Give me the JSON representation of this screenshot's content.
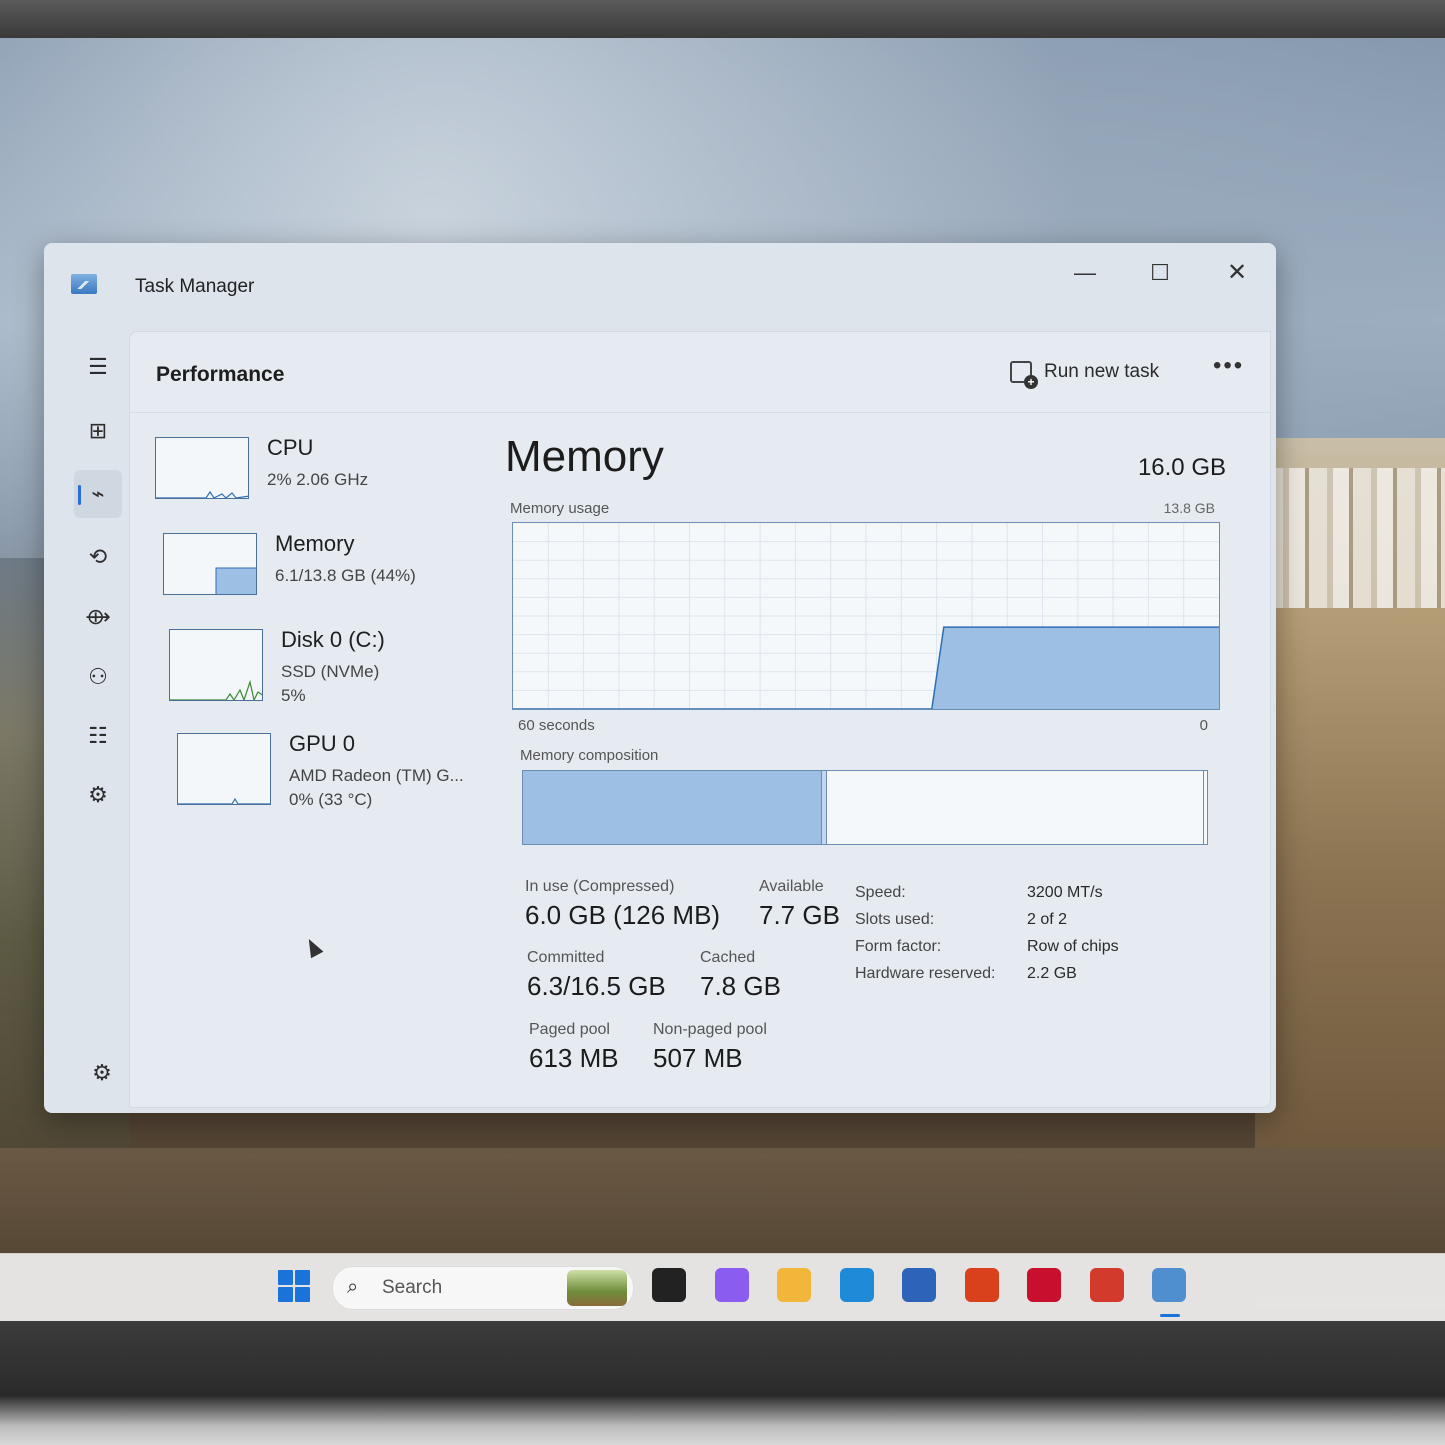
{
  "window": {
    "title": "Task Manager",
    "controls": {
      "minimize": "—",
      "maximize": "☐",
      "close": "✕"
    }
  },
  "nav": {
    "items": [
      {
        "name": "menu",
        "glyph": "☰"
      },
      {
        "name": "processes",
        "glyph": "⊞"
      },
      {
        "name": "performance",
        "glyph": "⌁",
        "active": true
      },
      {
        "name": "app-history",
        "glyph": "⟲"
      },
      {
        "name": "startup-apps",
        "glyph": "⟴"
      },
      {
        "name": "users",
        "glyph": "⚇"
      },
      {
        "name": "details",
        "glyph": "☷"
      },
      {
        "name": "services",
        "glyph": "⚙"
      }
    ],
    "settings_glyph": "⚙"
  },
  "header": {
    "page_title": "Performance",
    "run_new_task": "Run new task",
    "more": "•••"
  },
  "perf_list": [
    {
      "name": "CPU",
      "sub1": "2% 2.06 GHz",
      "sub2": "",
      "sub3": ""
    },
    {
      "name": "Memory",
      "sub1": "6.1/13.8 GB (44%)",
      "sub2": "",
      "sub3": ""
    },
    {
      "name": "Disk 0 (C:)",
      "sub1": "SSD (NVMe)",
      "sub2": "5%",
      "sub3": ""
    },
    {
      "name": "GPU 0",
      "sub1": "AMD Radeon (TM) G...",
      "sub2": "0% (33 °C)",
      "sub3": ""
    }
  ],
  "memory": {
    "title": "Memory",
    "total": "16.0 GB",
    "usage_label": "Memory usage",
    "usage_max": "13.8 GB",
    "time_left": "60 seconds",
    "time_right": "0",
    "usage_history_fraction": [
      0,
      0,
      0,
      0,
      0,
      0,
      0,
      0,
      0,
      0,
      0,
      0,
      0,
      0,
      0,
      0,
      0,
      0,
      0,
      0,
      0,
      0,
      0,
      0,
      0,
      0,
      0,
      0,
      0,
      0,
      0,
      0,
      0,
      0,
      0,
      0,
      0.44,
      0.44,
      0.44,
      0.44,
      0.44,
      0.44,
      0.44,
      0.44,
      0.44,
      0.44,
      0.44,
      0.44,
      0.44,
      0.44,
      0.44,
      0.44,
      0.44,
      0.44,
      0.44,
      0.44,
      0.44,
      0.44,
      0.44,
      0.44
    ],
    "composition_label": "Memory composition",
    "composition": {
      "in_use_fraction": 0.435,
      "modified_fraction": 0.01,
      "standby_fraction": 0.555
    },
    "stats": {
      "in_use_label": "In use (Compressed)",
      "in_use_value": "6.0 GB (126 MB)",
      "available_label": "Available",
      "available_value": "7.7 GB",
      "committed_label": "Committed",
      "committed_value": "6.3/16.5 GB",
      "cached_label": "Cached",
      "cached_value": "7.8 GB",
      "paged_label": "Paged pool",
      "paged_value": "613 MB",
      "nonpaged_label": "Non-paged pool",
      "nonpaged_value": "507 MB"
    },
    "specs": [
      {
        "key": "Speed:",
        "value": "3200 MT/s"
      },
      {
        "key": "Slots used:",
        "value": "2 of 2"
      },
      {
        "key": "Form factor:",
        "value": "Row of chips"
      },
      {
        "key": "Hardware reserved:",
        "value": "2.2 GB"
      }
    ]
  },
  "taskbar": {
    "search_placeholder": "Search",
    "apps": [
      {
        "name": "terminal",
        "color": "#222222"
      },
      {
        "name": "copilot",
        "color": "#8a5cf0"
      },
      {
        "name": "file-explorer",
        "color": "#f2b63a"
      },
      {
        "name": "edge",
        "color": "#1f8ad8"
      },
      {
        "name": "store",
        "color": "#2d63b8"
      },
      {
        "name": "l-app",
        "color": "#d9401c"
      },
      {
        "name": "mcafee",
        "color": "#c8102e"
      },
      {
        "name": "red-app",
        "color": "#d23a2c"
      },
      {
        "name": "task-manager",
        "color": "#4f8fd0"
      }
    ]
  },
  "colors": {
    "accent": "#2a6bd6",
    "graph_fill": "#9cbfe3",
    "graph_border": "#6b8db5"
  }
}
